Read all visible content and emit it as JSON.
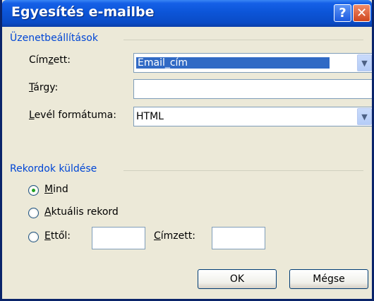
{
  "window": {
    "title": "Egyesítés e-mailbe",
    "help_glyph": "?",
    "close_glyph": "✕"
  },
  "message_options": {
    "group_label": "Üzenetbeállítások",
    "to": {
      "label_pre": "Cím",
      "label_acc": "z",
      "label_post": "ett:",
      "value": "Email_cím"
    },
    "subject": {
      "label_acc": "T",
      "label_post": "árgy:",
      "value": ""
    },
    "format": {
      "label_acc": "L",
      "label_post": "evél formátuma:",
      "value": "HTML"
    }
  },
  "send_records": {
    "group_label": "Rekordok küldése",
    "all": {
      "label_acc": "M",
      "label_post": "ind",
      "checked": true
    },
    "current": {
      "label_acc": "A",
      "label_post": "ktuális rekord",
      "checked": false
    },
    "from": {
      "label_acc": "E",
      "label_post": "ttől:",
      "checked": false,
      "value": ""
    },
    "to_record": {
      "label_acc": "C",
      "label_post": "ímzett:",
      "value": ""
    }
  },
  "buttons": {
    "ok": "OK",
    "cancel": "Mégse"
  }
}
